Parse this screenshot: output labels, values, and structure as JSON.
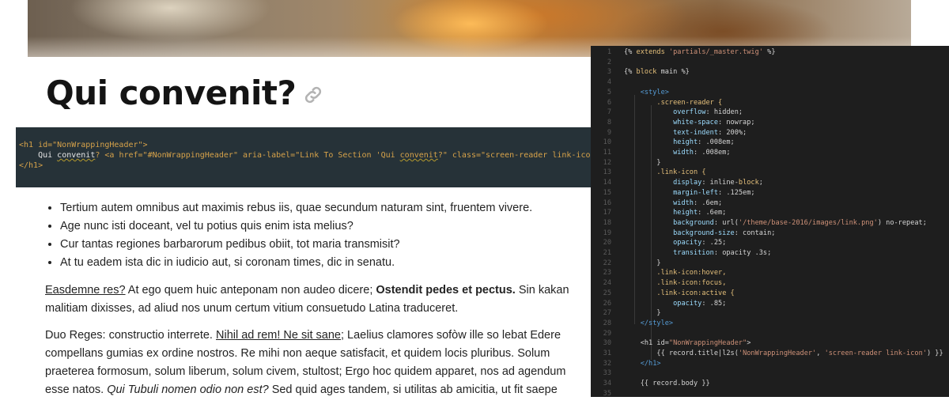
{
  "page": {
    "title": "Qui convenit?"
  },
  "snippet": {
    "line1": "<h1 id=\"NonWrappingHeader\">",
    "line2_text": "    Qui ",
    "line2_word": "convenit",
    "line2_rest": "? <a href=\"#NonWrappingHeader\" aria-label=\"Link To Section 'Qui ",
    "line2_word2": "convenit",
    "line2_tail": "?\" class=\"screen-reader link-icon\">Link</a>",
    "line3": "</h1>"
  },
  "list": [
    "Tertium autem omnibus aut maximis rebus iis, quae secundum naturam sint, fruentem vivere.",
    "Age nunc isti doceant, vel tu potius quis enim ista melius?",
    "Cur tantas regiones barbarorum pedibus obiit, tot maria transmisit?",
    "At tu eadem ista dic in iudicio aut, si coronam times, dic in senatu."
  ],
  "para1": {
    "link": "Easdemne res?",
    "text1": " At ego quem huic anteponam non audeo dicere; ",
    "bold": "Ostendit pedes et pectus.",
    "text2": " Sin kakan malitiam dixisses, ad aliud nos unum certum vitium consuetudo Latina traduceret."
  },
  "para2": {
    "text1": "Duo Reges: constructio interrete. ",
    "link": "Nihil ad rem! Ne sit sane;",
    "text2": " Laelius clamores sofòw ille so lebat Edere compellans gumias ex ordine nostros. Re mihi non aeque satisfacit, et quidem locis pluribus. Solum praeterea formosum, solum liberum, solum civem, stultost; Ergo hoc quidem apparet, nos ad agendum esse natos. ",
    "italic": "Qui Tubuli nomen odio non est?",
    "text3": " Sed quid ages tandem, si utilitas ab amicitia, ut fit saepe"
  },
  "editor": {
    "lines": [
      {
        "n": "1",
        "code": "{% extends 'partials/_master.twig' %}"
      },
      {
        "n": "2",
        "code": ""
      },
      {
        "n": "3",
        "code": "{% block main %}"
      },
      {
        "n": "4",
        "code": ""
      },
      {
        "n": "5",
        "code": "    <style>"
      },
      {
        "n": "6",
        "code": "        .screen-reader {"
      },
      {
        "n": "7",
        "code": "            overflow: hidden;"
      },
      {
        "n": "8",
        "code": "            white-space: nowrap;"
      },
      {
        "n": "9",
        "code": "            text-indent: 200%;"
      },
      {
        "n": "10",
        "code": "            height: .008em;"
      },
      {
        "n": "11",
        "code": "            width: .008em;"
      },
      {
        "n": "12",
        "code": "        }"
      },
      {
        "n": "13",
        "code": "        .link-icon {"
      },
      {
        "n": "14",
        "code": "            display: inline-block;"
      },
      {
        "n": "15",
        "code": "            margin-left: .125em;"
      },
      {
        "n": "16",
        "code": "            width: .6em;"
      },
      {
        "n": "17",
        "code": "            height: .6em;"
      },
      {
        "n": "18",
        "code": "            background: url('/theme/base-2016/images/link.png') no-repeat;"
      },
      {
        "n": "19",
        "code": "            background-size: contain;"
      },
      {
        "n": "20",
        "code": "            opacity: .25;"
      },
      {
        "n": "21",
        "code": "            transition: opacity .3s;"
      },
      {
        "n": "22",
        "code": "        }"
      },
      {
        "n": "23",
        "code": "        .link-icon:hover,"
      },
      {
        "n": "24",
        "code": "        .link-icon:focus,"
      },
      {
        "n": "25",
        "code": "        .link-icon:active {"
      },
      {
        "n": "26",
        "code": "            opacity: .85;"
      },
      {
        "n": "27",
        "code": "        }"
      },
      {
        "n": "28",
        "code": "    </style>"
      },
      {
        "n": "29",
        "code": ""
      },
      {
        "n": "30",
        "code": "    <h1 id=\"NonWrappingHeader\">"
      },
      {
        "n": "31",
        "code": "        {{ record.title|l2s('NonWrappingHeader', 'screen-reader link-icon') }}"
      },
      {
        "n": "32",
        "code": "    </h1>"
      },
      {
        "n": "33",
        "code": ""
      },
      {
        "n": "34",
        "code": "    {{ record.body }}"
      },
      {
        "n": "35",
        "code": ""
      }
    ]
  },
  "icons": {
    "permalink": "link-icon"
  },
  "colors": {
    "snippet_bg": "#263238",
    "editor_bg": "#1e1e1e",
    "tag_orange": "#d6a24a"
  }
}
